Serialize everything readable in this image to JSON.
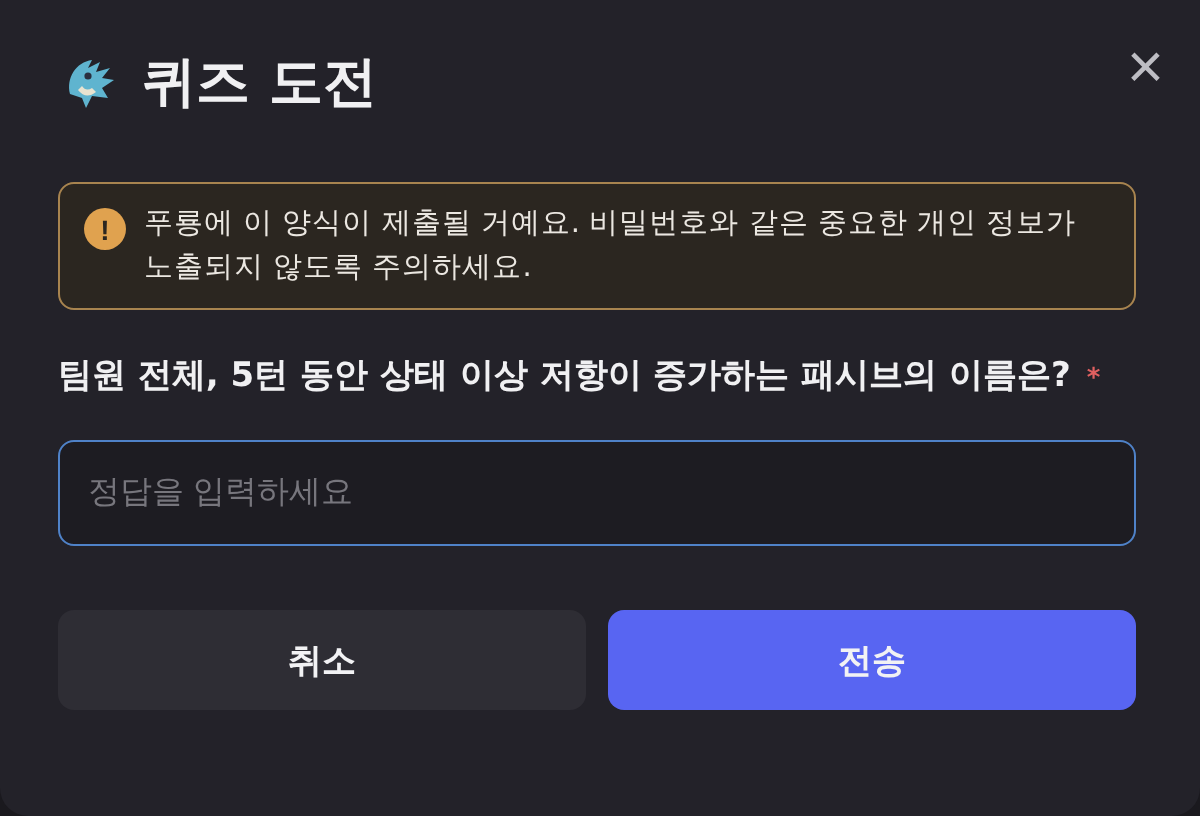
{
  "dialog": {
    "title": "퀴즈 도전",
    "close_label": "×"
  },
  "notice": {
    "icon": "!",
    "text": "푸룡에 이 양식이 제출될 거예요. 비밀번호와 같은 중요한 개인 정보가 노출되지 않도록 주의하세요."
  },
  "question": {
    "text": "팀원 전체, 5턴 동안 상태 이상 저항이 증가하는 패시브의 이름은?",
    "required": true,
    "required_mark": "*"
  },
  "answer": {
    "placeholder": "정답을 입력하세요"
  },
  "buttons": [
    {
      "label": "취소",
      "kind": "secondary"
    },
    {
      "label": "전송",
      "kind": "primary"
    }
  ]
}
